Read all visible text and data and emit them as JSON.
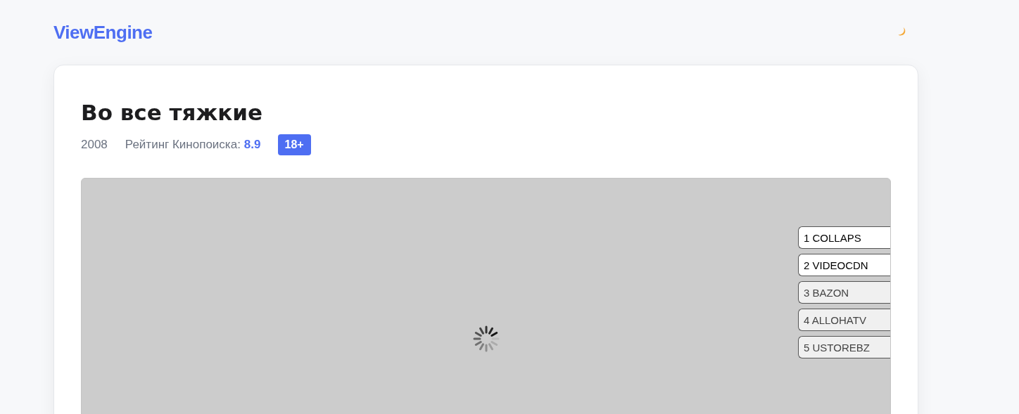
{
  "logo": "ViewEngine",
  "movie": {
    "title": "Во все тяжкие",
    "year": "2008",
    "rating_label": "Рейтинг Кинопоиска:",
    "rating": "8.9",
    "age": "18+"
  },
  "sources": [
    {
      "label": "1 COLLAPS",
      "selected": true
    },
    {
      "label": "2 VIDEOCDN",
      "selected": true
    },
    {
      "label": "3 BAZON",
      "selected": false
    },
    {
      "label": "4 ALLOHATV",
      "selected": false
    },
    {
      "label": "5 USTOREBZ",
      "selected": false
    }
  ]
}
